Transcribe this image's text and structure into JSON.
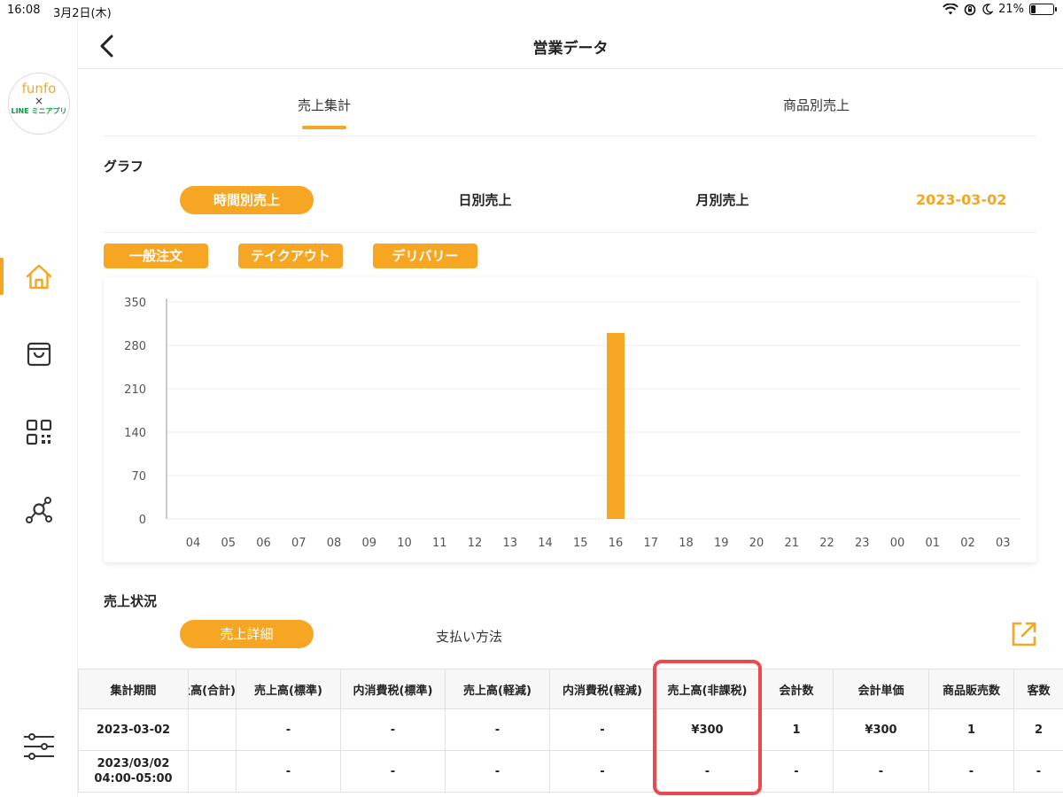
{
  "status_bar": {
    "time": "16:08",
    "date": "3月2日(木)",
    "battery": "21%",
    "battery_level": 0.21
  },
  "sidebar": {
    "logo": {
      "line1": "funfo",
      "line2": "×",
      "line3": "LINE ミニアプリ"
    },
    "icons": [
      "home-icon",
      "shopping-bag-icon",
      "qr-code-icon",
      "share-network-icon",
      "sliders-icon"
    ],
    "active": "home-icon"
  },
  "header": {
    "title": "営業データ"
  },
  "tabs": [
    {
      "label": "売上集計"
    },
    {
      "label": "商品別売上"
    }
  ],
  "graph": {
    "label": "グラフ",
    "period_pills": [
      {
        "label": "時間別売上"
      },
      {
        "label": "日別売上"
      },
      {
        "label": "月別売上"
      }
    ],
    "selected_date": "2023-03-02",
    "order_type_chips": [
      {
        "label": "一般注文"
      },
      {
        "label": "テイクアウト"
      },
      {
        "label": "デリバリー"
      }
    ]
  },
  "chart_data": {
    "type": "bar",
    "categories": [
      "04",
      "05",
      "06",
      "07",
      "08",
      "09",
      "10",
      "11",
      "12",
      "13",
      "14",
      "15",
      "16",
      "17",
      "18",
      "19",
      "20",
      "21",
      "22",
      "23",
      "00",
      "01",
      "02",
      "03"
    ],
    "values": [
      0,
      0,
      0,
      0,
      0,
      0,
      0,
      0,
      0,
      0,
      0,
      0,
      300,
      0,
      0,
      0,
      0,
      0,
      0,
      0,
      0,
      0,
      0,
      0
    ],
    "y_ticks": [
      0,
      70,
      140,
      210,
      280,
      350
    ],
    "ylim": [
      0,
      350
    ],
    "grid": true,
    "bar_color": "#f6a623"
  },
  "sales_status": {
    "label": "売上状況",
    "subtabs": [
      {
        "label": "売上詳細"
      },
      {
        "label": "支払い方法"
      }
    ]
  },
  "table": {
    "columns": [
      "集計期間",
      "売上高(合計)",
      "売上高(標準)",
      "内消費税(標準)",
      "売上高(軽減)",
      "内消費税(軽減)",
      "売上高(非課税)",
      "会計数",
      "会計単価",
      "商品販売数",
      "客数"
    ],
    "rows": [
      {
        "period_line1": "2023-03-02",
        "period_line2": "",
        "cells": [
          "",
          "-",
          "-",
          "-",
          "-",
          "¥300",
          "1",
          "¥300",
          "1",
          "2"
        ]
      },
      {
        "period_line1": "2023/03/02",
        "period_line2": "04:00-05:00",
        "cells": [
          "",
          "-",
          "-",
          "-",
          "-",
          "-",
          "-",
          "-",
          "-",
          "-"
        ]
      }
    ]
  },
  "colors": {
    "accent": "#f6a623",
    "highlight": "#e84a4f"
  }
}
